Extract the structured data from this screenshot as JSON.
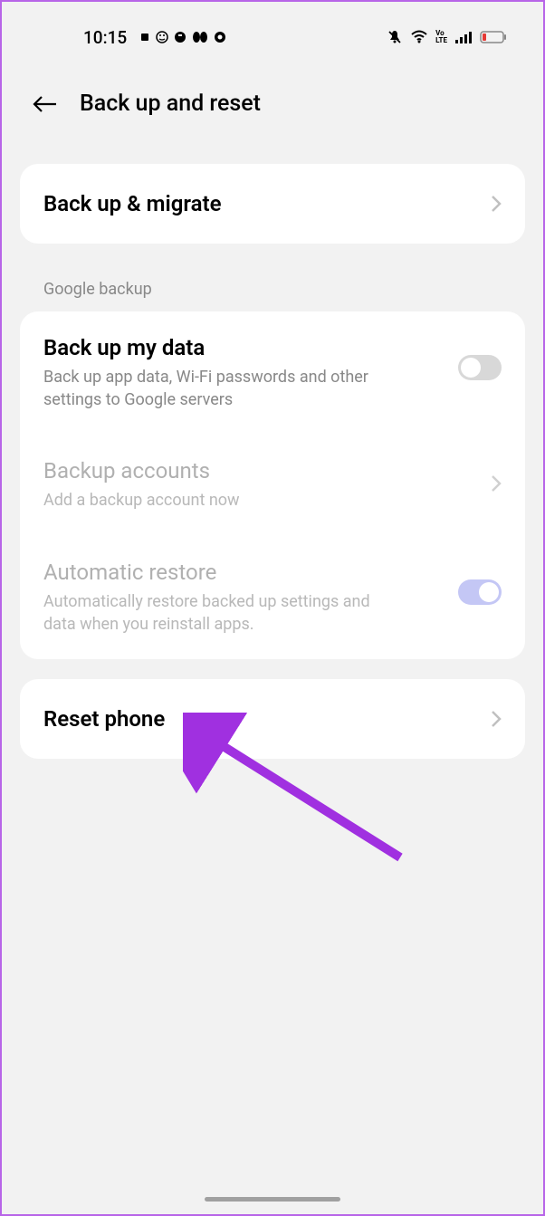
{
  "status_bar": {
    "time": "10:15"
  },
  "header": {
    "title": "Back up and reset"
  },
  "backup_migrate": {
    "title": "Back up & migrate"
  },
  "google_section": {
    "label": "Google backup",
    "backup_my_data": {
      "title": "Back up my data",
      "subtitle": "Back up app data, Wi-Fi passwords and other settings to Google servers"
    },
    "backup_accounts": {
      "title": "Backup accounts",
      "subtitle": "Add a backup account now"
    },
    "automatic_restore": {
      "title": "Automatic restore",
      "subtitle": "Automatically restore backed up settings and data when you reinstall apps."
    }
  },
  "reset": {
    "title": "Reset phone"
  }
}
